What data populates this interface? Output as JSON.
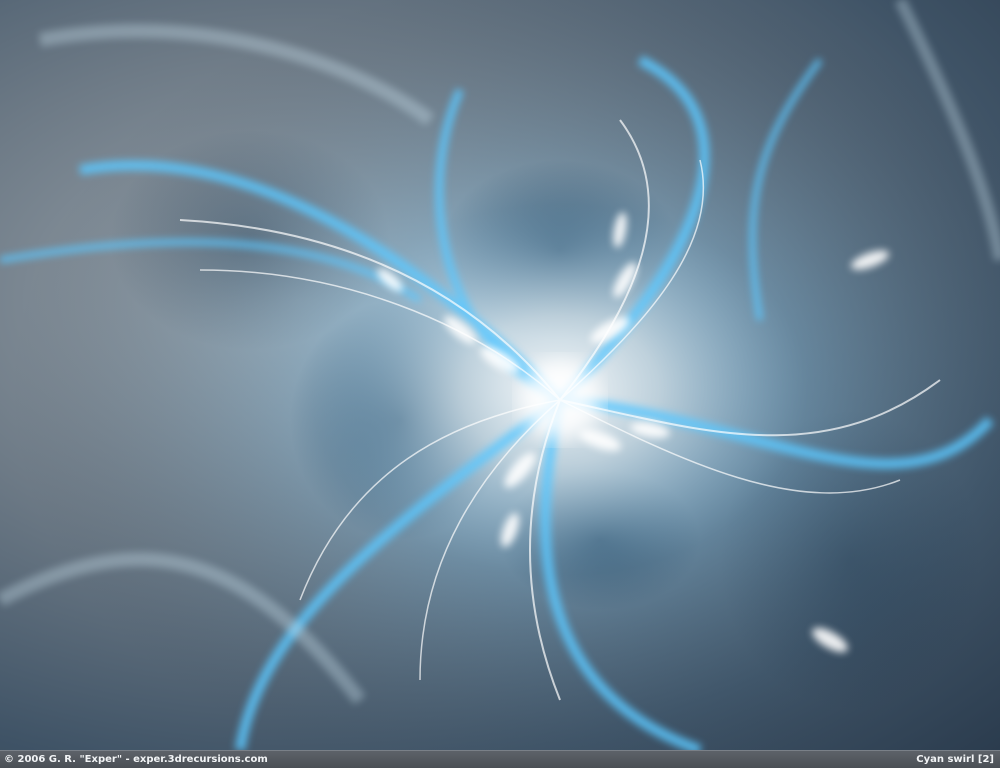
{
  "artwork": {
    "description_icon": "fractal-swirl-image",
    "colors": {
      "glow": "#5cc8ff",
      "highlight": "#ffffff",
      "midtone": "#8fa0ad",
      "shadow": "#2c3e50"
    }
  },
  "footer": {
    "credit": "© 2006 G. R. \"Exper\" - exper.3drecursions.com",
    "title": "Cyan swirl [2]"
  }
}
